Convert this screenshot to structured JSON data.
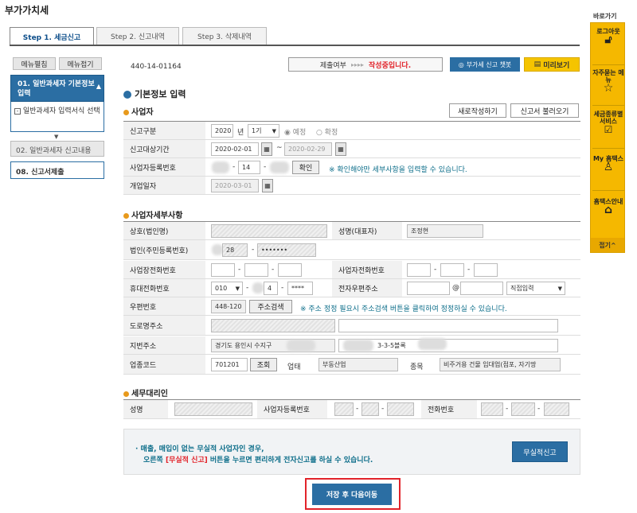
{
  "page_title": "부가가치세",
  "tabs": [
    "Step 1. 세금신고",
    "Step 2. 신고내역",
    "Step 3. 삭제내역"
  ],
  "left": {
    "expand": "메뉴펼침",
    "collapse": "메뉴접기",
    "menu1": "01. 일반과세자 기본정보 입력",
    "menu1_sub": "일반과세자 입력서식 선택",
    "menu2": "02. 일반과세자 신고내용",
    "menu3": "08. 신고서제출"
  },
  "header": {
    "biz_no": "440-14-01164",
    "submit_label": "제출여부",
    "submit_arrows": "▸▸▸▸",
    "submit_status": "작성중입니다.",
    "chatbot": "부가세 신고 챗봇",
    "preview": "미리보기"
  },
  "section_title": "기본정보 입력",
  "operator": {
    "title": "사업자",
    "new_write": "새로작성하기",
    "load": "신고서 불러오기",
    "report_type_label": "신고구분",
    "year": "2020",
    "year_unit": "년",
    "period": "1기",
    "radio_scheduled": "예정",
    "radio_final": "확정",
    "period_label": "신고대상기간",
    "date_from": "2020-02-01",
    "tilde": "~",
    "date_to": "2020-02-29",
    "reg_label": "사업자등록번호",
    "reg_mid": "14",
    "confirm": "확인",
    "reg_note": "※ 확인해야만 세부사항을 입력할 수 있습니다.",
    "open_label": "개업일자",
    "open_date": "2020-03-01"
  },
  "details": {
    "title": "사업자세부사항",
    "company_label": "상호(법인명)",
    "ceo_label": "성명(대표자)",
    "ceo_value": "조정현",
    "id_label": "법인(주민등록번호)",
    "id_front": "28",
    "id_back": "•••••••",
    "biz_phone_label": "사업장전화번호",
    "home_phone_label": "사업자전화번호",
    "mobile_label": "휴대전화번호",
    "mobile_1": "010",
    "mobile_2": "4",
    "mobile_3": "****",
    "email_label": "전자우편주소",
    "at": "@",
    "email_select": "직접입력",
    "zip_label": "우편번호",
    "zip_value": "448-120",
    "addr_search": "주소검색",
    "zip_note": "※ 주소 정정 필요시 주소검색 버튼을 클릭하여 정정하실 수 있습니다.",
    "road_label": "도로명주소",
    "lot_label": "지번주소",
    "lot_value": "경기도 용인시 수지구",
    "lot_detail": "3-3-5블록",
    "biz_code_label": "업종코드",
    "biz_code": "701201",
    "lookup": "조회",
    "type_label": "업태",
    "type_value": "부동산업",
    "item_label": "종목",
    "item_value": "비주거용 건물 임대업(점포, 자기땅"
  },
  "agent": {
    "title": "세무대리인",
    "name_label": "성명",
    "reg_label": "사업자등록번호",
    "phone_label": "전화번호"
  },
  "info": {
    "line1": "· 매출, 매입이 없는 무실적 사업자인 경우,",
    "line2_pre": "오른쪽 ",
    "line2_red": "[무실적 신고]",
    "line2_post": " 버튼을 누르면 편리하게 전자신고를 하실 수 있습니다.",
    "no_perf_btn": "무실적신고"
  },
  "save_next": "저장 후 다음이동",
  "quick": {
    "title": "바로가기",
    "logout": "로그아웃",
    "faq": "자주묻는 메뉴",
    "tax_service": "세금종류별 서비스",
    "my_hometax": "My 홈택스",
    "guide": "홈택스안내",
    "close": "접기"
  },
  "colors": {
    "accent": "#2b6ea3",
    "quick": "#f5b800",
    "status_red": "#e2232a",
    "note": "#0d6e8a"
  }
}
